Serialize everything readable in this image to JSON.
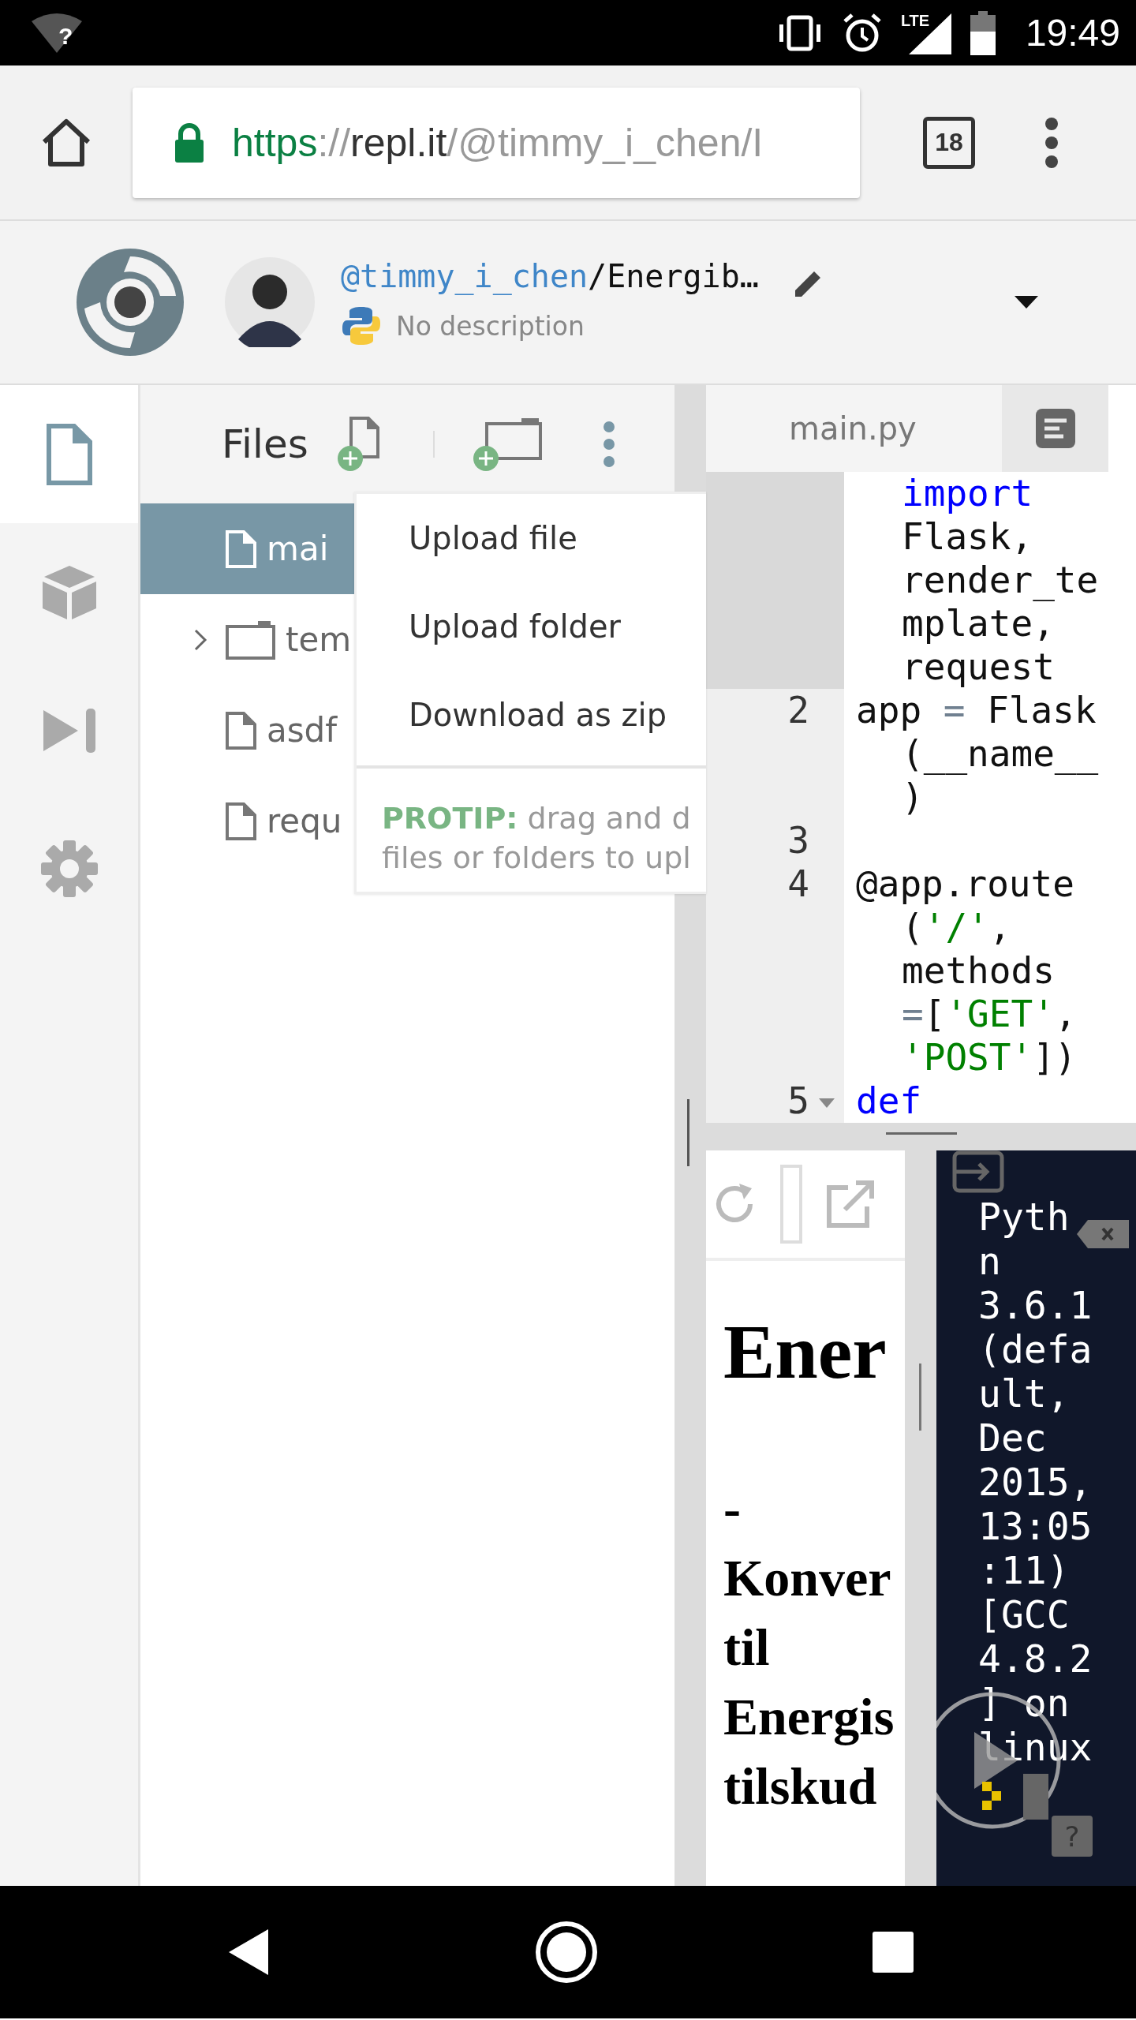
{
  "status_bar": {
    "wifi_badge": "?",
    "network": "LTE",
    "time": "19:49"
  },
  "browser": {
    "url_parts": [
      {
        "text": "https",
        "kind": "scheme"
      },
      {
        "text": "://",
        "kind": "faded"
      },
      {
        "text": "repl.it",
        "kind": "host"
      },
      {
        "text": "/@timmy_i_chen/I",
        "kind": "faded"
      }
    ],
    "tab_count": "18"
  },
  "repl": {
    "owner": "@timmy_i_chen",
    "separator": "/",
    "name": "Energib…",
    "description": "No description"
  },
  "sidebar": {
    "items": [
      {
        "kind": "files",
        "selected": true
      },
      {
        "kind": "packages",
        "selected": false
      },
      {
        "kind": "debugger",
        "selected": false
      },
      {
        "kind": "settings",
        "selected": false
      }
    ]
  },
  "files": {
    "title": "Files",
    "items": [
      {
        "kind": "file",
        "name": "mai",
        "selected": true
      },
      {
        "kind": "folder",
        "name": "tem",
        "selected": false,
        "expanded": false
      },
      {
        "kind": "file",
        "name": "asdf",
        "selected": false
      },
      {
        "kind": "file",
        "name": "requ",
        "selected": false
      }
    ]
  },
  "menu": {
    "items": [
      "Upload file",
      "Upload folder",
      "Download as zip"
    ],
    "protip": [
      "**PROTIP:** drag and d",
      "files or folders to upl"
    ]
  },
  "editor": {
    "tab": "main.py",
    "lines": [
      {
        "continued": true,
        "active": true,
        "foldable": false,
        "rows": [
          {
            "tokens": [
              {
                "text": "import",
                "kind": "keyword"
              }
            ]
          },
          {
            "tokens": [
              {
                "text": "Flask,",
                "kind": "plain"
              }
            ]
          },
          {
            "tokens": [
              {
                "text": "render_te",
                "kind": "plain"
              }
            ]
          },
          {
            "tokens": [
              {
                "text": "mplate,",
                "kind": "plain"
              }
            ]
          },
          {
            "tokens": [
              {
                "text": "request",
                "kind": "plain"
              }
            ]
          }
        ]
      },
      {
        "number": "2",
        "continued": false,
        "active": false,
        "foldable": false,
        "rows": [
          {
            "tokens": [
              {
                "text": "app ",
                "kind": "plain"
              },
              {
                "text": "=",
                "kind": "operator"
              },
              {
                "text": " Flask",
                "kind": "plain"
              }
            ]
          },
          {
            "tokens": [
              {
                "text": "(__name__",
                "kind": "plain"
              }
            ]
          },
          {
            "tokens": [
              {
                "text": ")",
                "kind": "plain"
              }
            ]
          }
        ]
      },
      {
        "number": "3",
        "continued": false,
        "active": false,
        "foldable": false
      },
      {
        "number": "4",
        "continued": false,
        "active": false,
        "foldable": false,
        "rows": [
          {
            "tokens": [
              {
                "text": "@app.route",
                "kind": "plain"
              }
            ]
          },
          {
            "tokens": [
              {
                "text": "(",
                "kind": "plain"
              },
              {
                "text": "'/'",
                "kind": "string"
              },
              {
                "text": ",",
                "kind": "plain"
              }
            ]
          },
          {
            "tokens": [
              {
                "text": "methods",
                "kind": "plain"
              }
            ]
          },
          {
            "tokens": [
              {
                "text": "=",
                "kind": "operator"
              },
              {
                "text": "[",
                "kind": "plain"
              },
              {
                "text": "'GET'",
                "kind": "string"
              },
              {
                "text": ",",
                "kind": "plain"
              }
            ]
          },
          {
            "tokens": [
              {
                "text": "'POST'",
                "kind": "string"
              },
              {
                "text": "])",
                "kind": "plain"
              }
            ]
          }
        ]
      },
      {
        "number": "5",
        "continued": false,
        "active": false,
        "foldable": true,
        "rows": [
          {
            "tokens": [
              {
                "text": "def",
                "kind": "keyword"
              }
            ]
          }
        ]
      }
    ]
  },
  "preview": {
    "heading": "Ener",
    "lines": [
      "-",
      "Konver",
      "til",
      "Energis",
      "tilskud"
    ]
  },
  "console": {
    "lines": [
      "Pyth",
      "n",
      "3.6.1",
      "(defa",
      "ult,",
      "Dec",
      "2015,",
      "13:05",
      ":11)",
      "[GCC",
      "4.8.2",
      "] on",
      "linux"
    ],
    "help": "?"
  }
}
